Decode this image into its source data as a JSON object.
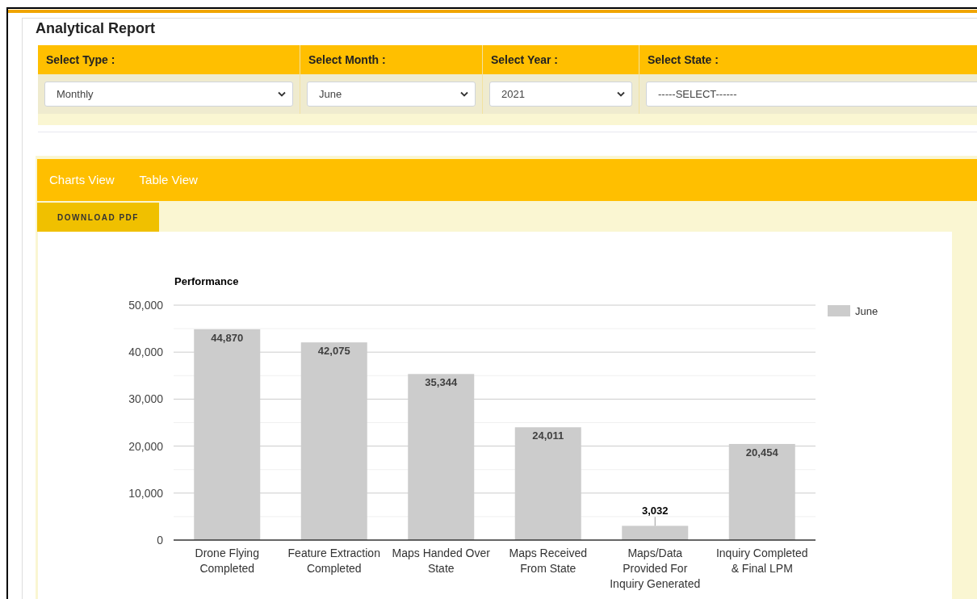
{
  "title": "Analytical Report",
  "filters": [
    {
      "label": "Select Type :",
      "value": "Monthly",
      "arrow": true
    },
    {
      "label": "Select Month :",
      "value": "June",
      "arrow": true
    },
    {
      "label": "Select Year :",
      "value": "2021",
      "arrow": true
    },
    {
      "label": "Select State :",
      "value": "-----SELECT------",
      "arrow": false
    }
  ],
  "tabs": [
    {
      "label": "Charts View"
    },
    {
      "label": "Table View"
    }
  ],
  "download_button": "DOWNLOAD PDF",
  "chart_data": {
    "type": "bar",
    "title": "Performance",
    "categories": [
      "Drone Flying Completed",
      "Feature Extraction Completed",
      "Maps Handed Over State",
      "Maps Received From State",
      "Maps/Data Provided For Inquiry Generated",
      "Inquiry Completed & Final LPM"
    ],
    "series": [
      {
        "name": "June",
        "color": "#cccccc",
        "values": [
          44870,
          42075,
          35344,
          24011,
          3032,
          20454
        ]
      }
    ],
    "ylim": [
      0,
      50000
    ],
    "yticks": [
      {
        "value": 0,
        "label": "0"
      },
      {
        "value": 10000,
        "label": "10,000"
      },
      {
        "value": 20000,
        "label": "20,000"
      },
      {
        "value": 30000,
        "label": "30,000"
      },
      {
        "value": 40000,
        "label": "40,000"
      },
      {
        "value": 50000,
        "label": "50,000"
      }
    ],
    "value_labels": [
      "44,870",
      "42,075",
      "35,344",
      "24,011",
      "3,032",
      "20,454"
    ],
    "grid": true
  }
}
